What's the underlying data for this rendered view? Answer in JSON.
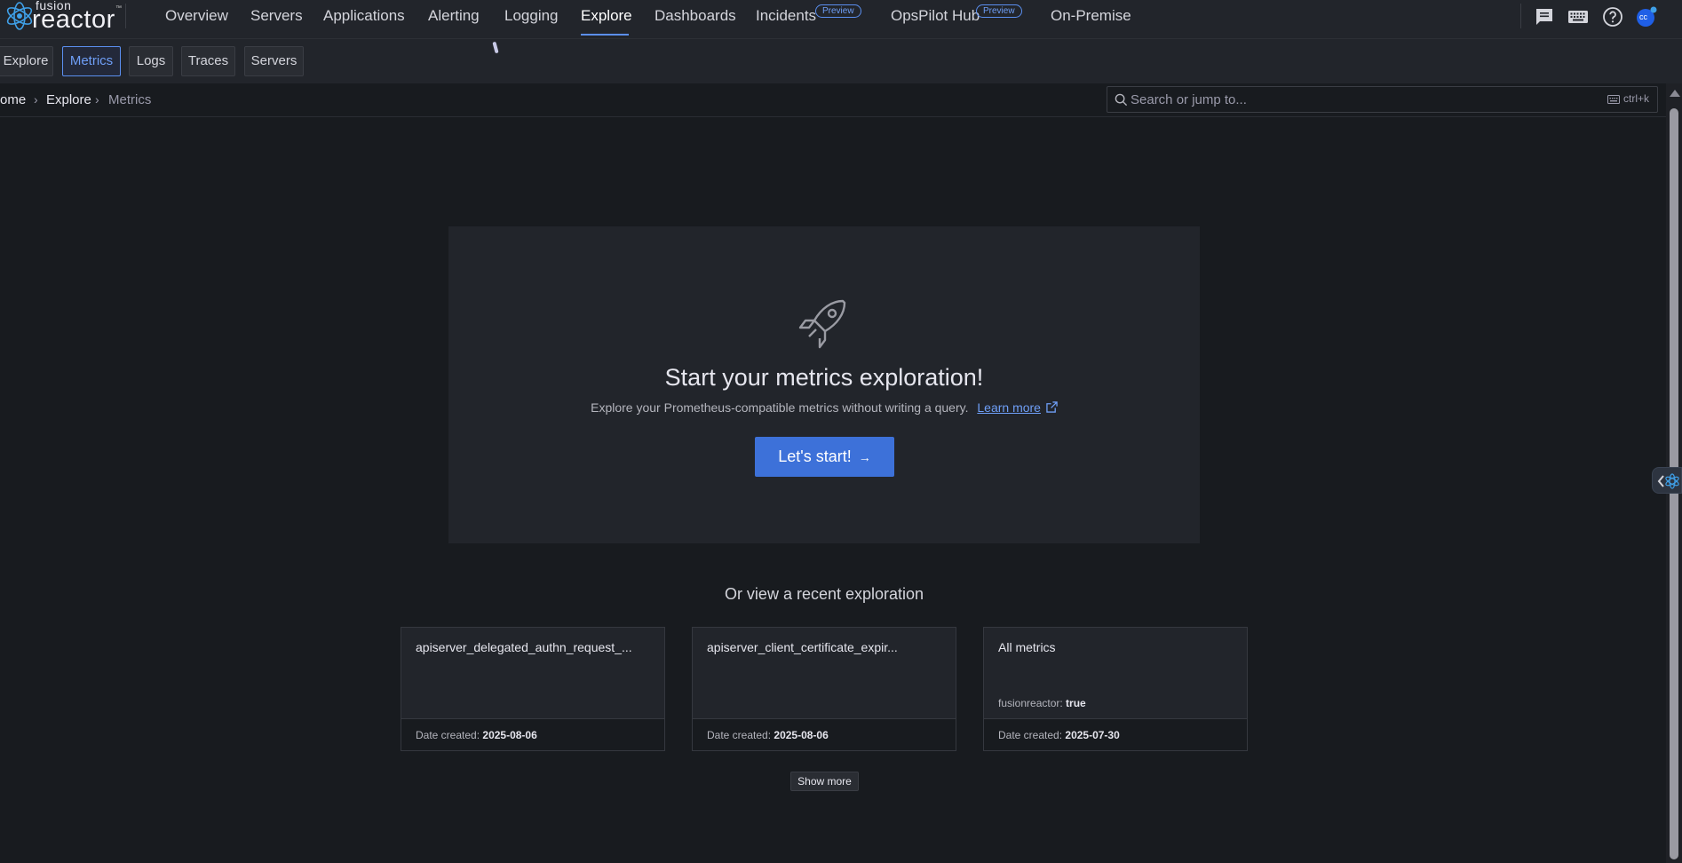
{
  "brand": {
    "small": "fusion",
    "large": "reactor",
    "tm": "™"
  },
  "nav": {
    "overview": "Overview",
    "servers": "Servers",
    "applications": "Applications",
    "alerting": "Alerting",
    "logging": "Logging",
    "explore": "Explore",
    "dashboards": "Dashboards",
    "incidents": "Incidents",
    "incidents_badge": "Preview",
    "opspilot": "OpsPilot Hub",
    "opspilot_badge": "Preview",
    "onpremise": "On-Premise"
  },
  "user": {
    "initials": "cc"
  },
  "subtabs": [
    "Explore",
    "Metrics",
    "Logs",
    "Traces",
    "Servers"
  ],
  "breadcrumb": [
    "ome",
    "Explore",
    "Metrics"
  ],
  "search": {
    "placeholder": "Search or jump to...",
    "shortcut": "ctrl+k"
  },
  "hero": {
    "title": "Start your metrics exploration!",
    "description": "Explore your Prometheus-compatible metrics without writing a query.",
    "learn_more": "Learn more",
    "start_button": "Let's start!",
    "start_arrow": "→"
  },
  "recent": {
    "title": "Or view a recent exploration",
    "date_label": "Date created:",
    "cards": [
      {
        "title": "apiserver_delegated_authn_request_...",
        "extra_key": "",
        "extra_value": "",
        "date": "2025-08-06"
      },
      {
        "title": "apiserver_client_certificate_expir...",
        "extra_key": "",
        "extra_value": "",
        "date": "2025-08-06"
      },
      {
        "title": "All metrics",
        "extra_key": "fusionreactor:",
        "extra_value": "true",
        "date": "2025-07-30"
      }
    ],
    "show_more": "Show more"
  },
  "colors": {
    "accent": "#3d71d9",
    "link": "#6f9ff7",
    "background": "#181b1f",
    "panel": "#22252b"
  }
}
